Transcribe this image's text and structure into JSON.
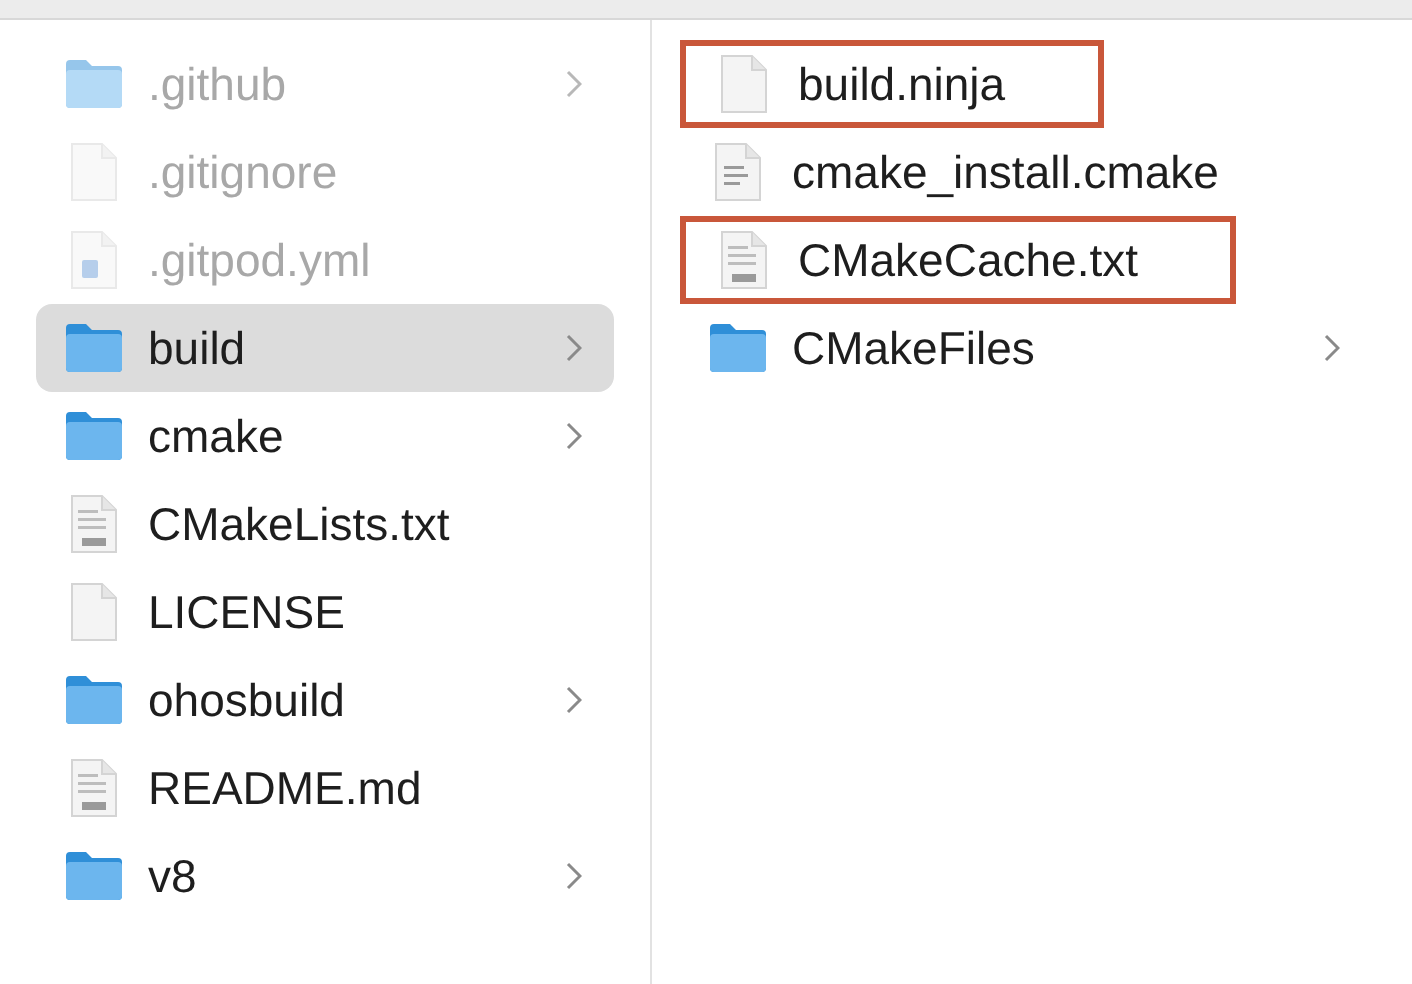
{
  "columns": [
    {
      "items": [
        {
          "name": ".github",
          "kind": "folder",
          "hidden": true,
          "selected": false,
          "has_children": true
        },
        {
          "name": ".gitignore",
          "kind": "blank",
          "hidden": true,
          "selected": false,
          "has_children": false
        },
        {
          "name": ".gitpod.yml",
          "kind": "yaml",
          "hidden": true,
          "selected": false,
          "has_children": false
        },
        {
          "name": "build",
          "kind": "folder",
          "hidden": false,
          "selected": true,
          "has_children": true
        },
        {
          "name": "cmake",
          "kind": "folder",
          "hidden": false,
          "selected": false,
          "has_children": true
        },
        {
          "name": "CMakeLists.txt",
          "kind": "txt",
          "hidden": false,
          "selected": false,
          "has_children": false
        },
        {
          "name": "LICENSE",
          "kind": "blank",
          "hidden": false,
          "selected": false,
          "has_children": false
        },
        {
          "name": "ohosbuild",
          "kind": "folder",
          "hidden": false,
          "selected": false,
          "has_children": true
        },
        {
          "name": "README.md",
          "kind": "md",
          "hidden": false,
          "selected": false,
          "has_children": false
        },
        {
          "name": "v8",
          "kind": "folder",
          "hidden": false,
          "selected": false,
          "has_children": true
        }
      ]
    },
    {
      "items": [
        {
          "name": "build.ninja",
          "kind": "blank",
          "highlighted": true,
          "selected": false,
          "has_children": false
        },
        {
          "name": "cmake_install.cmake",
          "kind": "script",
          "highlighted": false,
          "selected": false,
          "has_children": false
        },
        {
          "name": "CMakeCache.txt",
          "kind": "txt",
          "highlighted": true,
          "selected": false,
          "has_children": false
        },
        {
          "name": "CMakeFiles",
          "kind": "folder",
          "highlighted": false,
          "selected": false,
          "has_children": true
        }
      ]
    }
  ]
}
